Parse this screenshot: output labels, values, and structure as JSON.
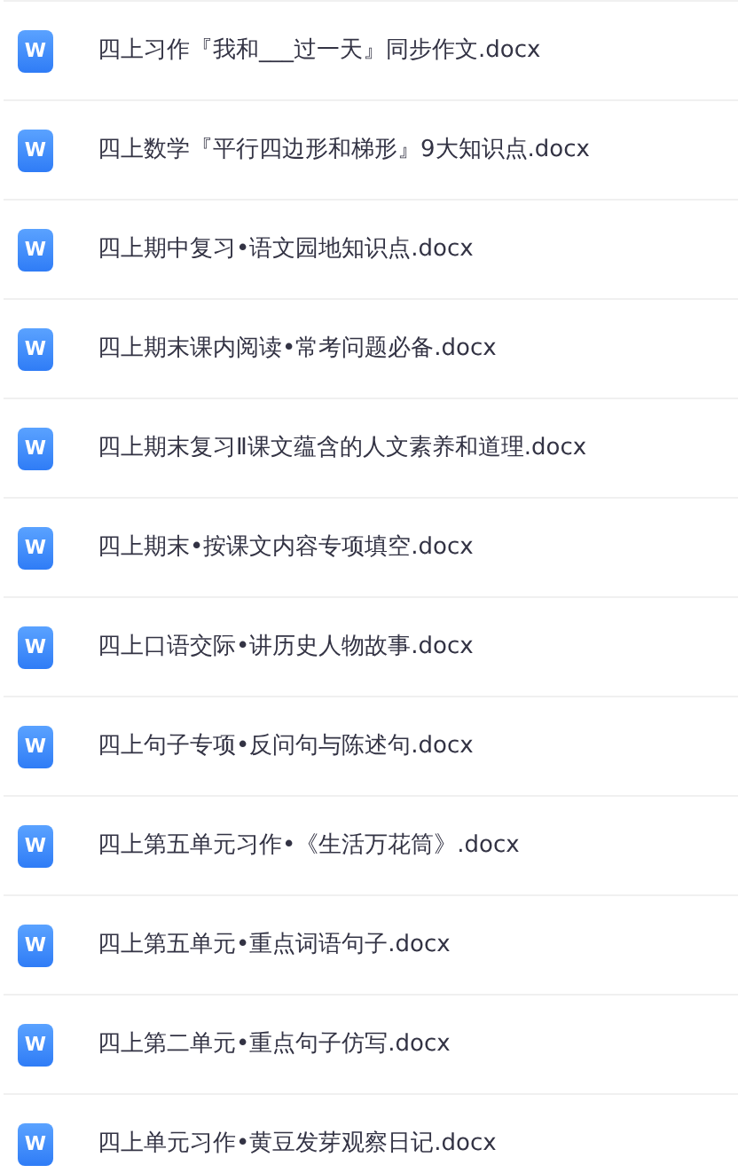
{
  "files": [
    {
      "name": "四上习作『我和___过一天』同步作文.docx",
      "icon_label": "W"
    },
    {
      "name": "四上数学『平行四边形和梯形』9大知识点.docx",
      "icon_label": "W"
    },
    {
      "name": "四上期中复习•语文园地知识点.docx",
      "icon_label": "W"
    },
    {
      "name": "四上期末课内阅读•常考问题必备.docx",
      "icon_label": "W"
    },
    {
      "name": "四上期末复习Ⅱ课文蕴含的人文素养和道理.docx",
      "icon_label": "W"
    },
    {
      "name": "四上期末•按课文内容专项填空.docx",
      "icon_label": "W"
    },
    {
      "name": "四上口语交际•讲历史人物故事.docx",
      "icon_label": "W"
    },
    {
      "name": "四上句子专项•反问句与陈述句.docx",
      "icon_label": "W"
    },
    {
      "name": "四上第五单元习作•《生活万花筒》.docx",
      "icon_label": "W"
    },
    {
      "name": "四上第五单元•重点词语句子.docx",
      "icon_label": "W"
    },
    {
      "name": "四上第二单元•重点句子仿写.docx",
      "icon_label": "W"
    },
    {
      "name": "四上单元习作•黄豆发芽观察日记.docx",
      "icon_label": "W"
    }
  ]
}
